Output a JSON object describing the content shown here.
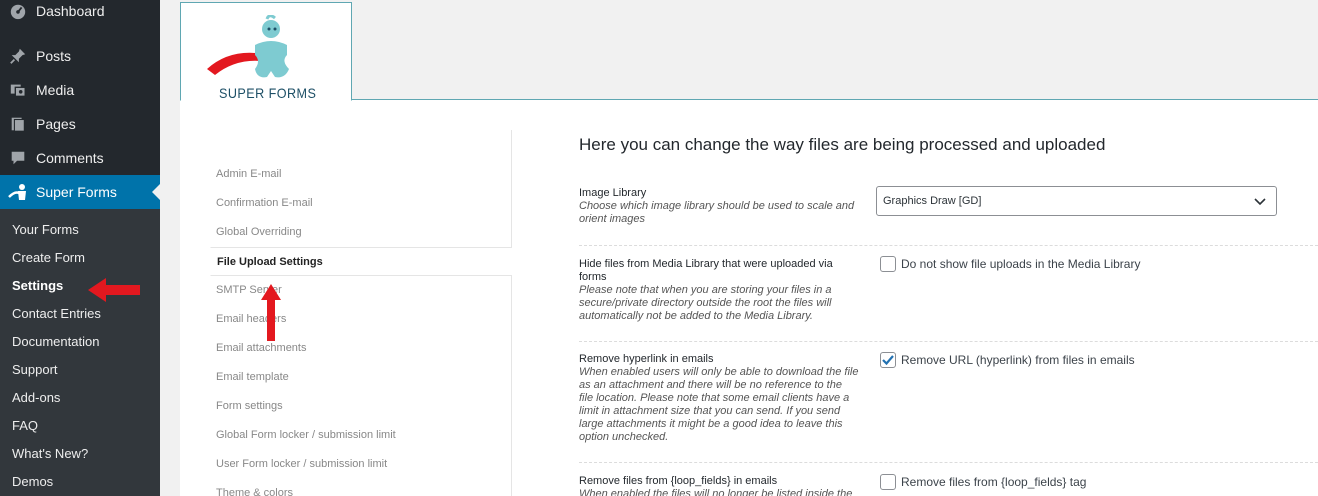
{
  "sidebar": {
    "menu": [
      {
        "label": "Dashboard",
        "icon": "dashboard-icon"
      },
      {
        "label": "Posts",
        "icon": "pin-icon"
      },
      {
        "label": "Media",
        "icon": "media-icon"
      },
      {
        "label": "Pages",
        "icon": "pages-icon"
      },
      {
        "label": "Comments",
        "icon": "comment-icon"
      },
      {
        "label": "Super Forms",
        "icon": "super-forms-icon"
      }
    ],
    "submenu": [
      "Your Forms",
      "Create Form",
      "Settings",
      "Contact Entries",
      "Documentation",
      "Support",
      "Add-ons",
      "FAQ",
      "What's New?",
      "Demos"
    ],
    "accent_color": "#0073aa"
  },
  "plugin": {
    "logo_text": "SUPER FORMS"
  },
  "settings_tabs": [
    "Admin E-mail",
    "Confirmation E-mail",
    "Global Overriding",
    "File Upload Settings",
    "SMTP Server",
    "Email headers",
    "Email attachments",
    "Email template",
    "Form settings",
    "Global Form locker / submission limit",
    "User Form locker / submission limit",
    "Theme & colors"
  ],
  "panel": {
    "title": "Here you can change the way files are being processed and uploaded",
    "image_library": {
      "label": "Image Library",
      "desc": "Choose which image library should be used to scale and orient images",
      "value": "Graphics Draw [GD]"
    },
    "hide_media": {
      "label": "Hide files from Media Library that were uploaded via forms",
      "desc": "Please note that when you are storing your files in a secure/private directory outside the root the files will automatically not be added to the Media Library.",
      "option": "Do not show file uploads in the Media Library",
      "checked": false
    },
    "remove_hyperlink": {
      "label": "Remove hyperlink in emails",
      "desc": "When enabled users will only be able to download the file as an attachment and there will be no reference to the file location. Please note that some email clients have a limit in attachment size that you can send. If you send large attachments it might be a good idea to leave this option unchecked.",
      "option": "Remove URL (hyperlink) from files in emails",
      "checked": true
    },
    "remove_loop": {
      "label": "Remove files from {loop_fields} in emails",
      "desc": "When enabled the files will no longer be listed inside the",
      "option": "Remove files from {loop_fields} tag",
      "checked": false
    }
  },
  "annotation_color": "#e3181f"
}
